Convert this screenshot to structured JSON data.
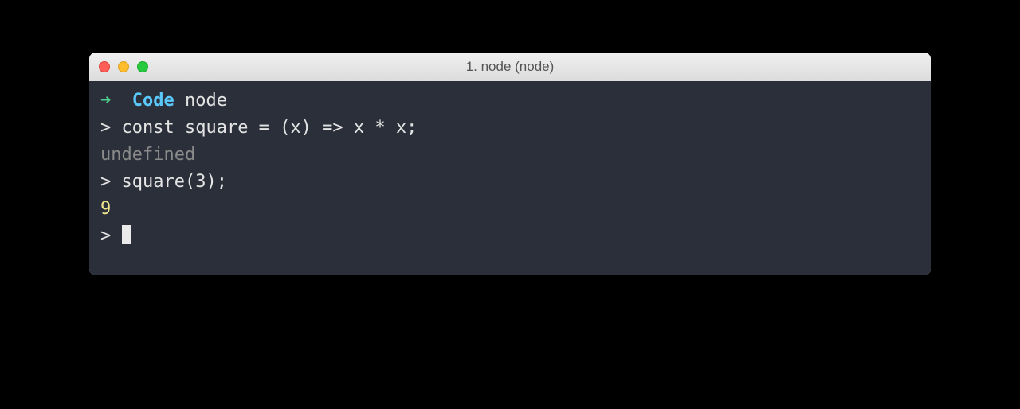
{
  "window": {
    "title": "1. node (node)"
  },
  "shell": {
    "arrow": "➜",
    "cwd": "Code",
    "command": "node"
  },
  "repl": {
    "prompt": ">",
    "lines": [
      {
        "input": "const square = (x) => x * x;"
      },
      {
        "output_undefined": "undefined"
      },
      {
        "input": "square(3);"
      },
      {
        "output_number": "9"
      }
    ]
  }
}
